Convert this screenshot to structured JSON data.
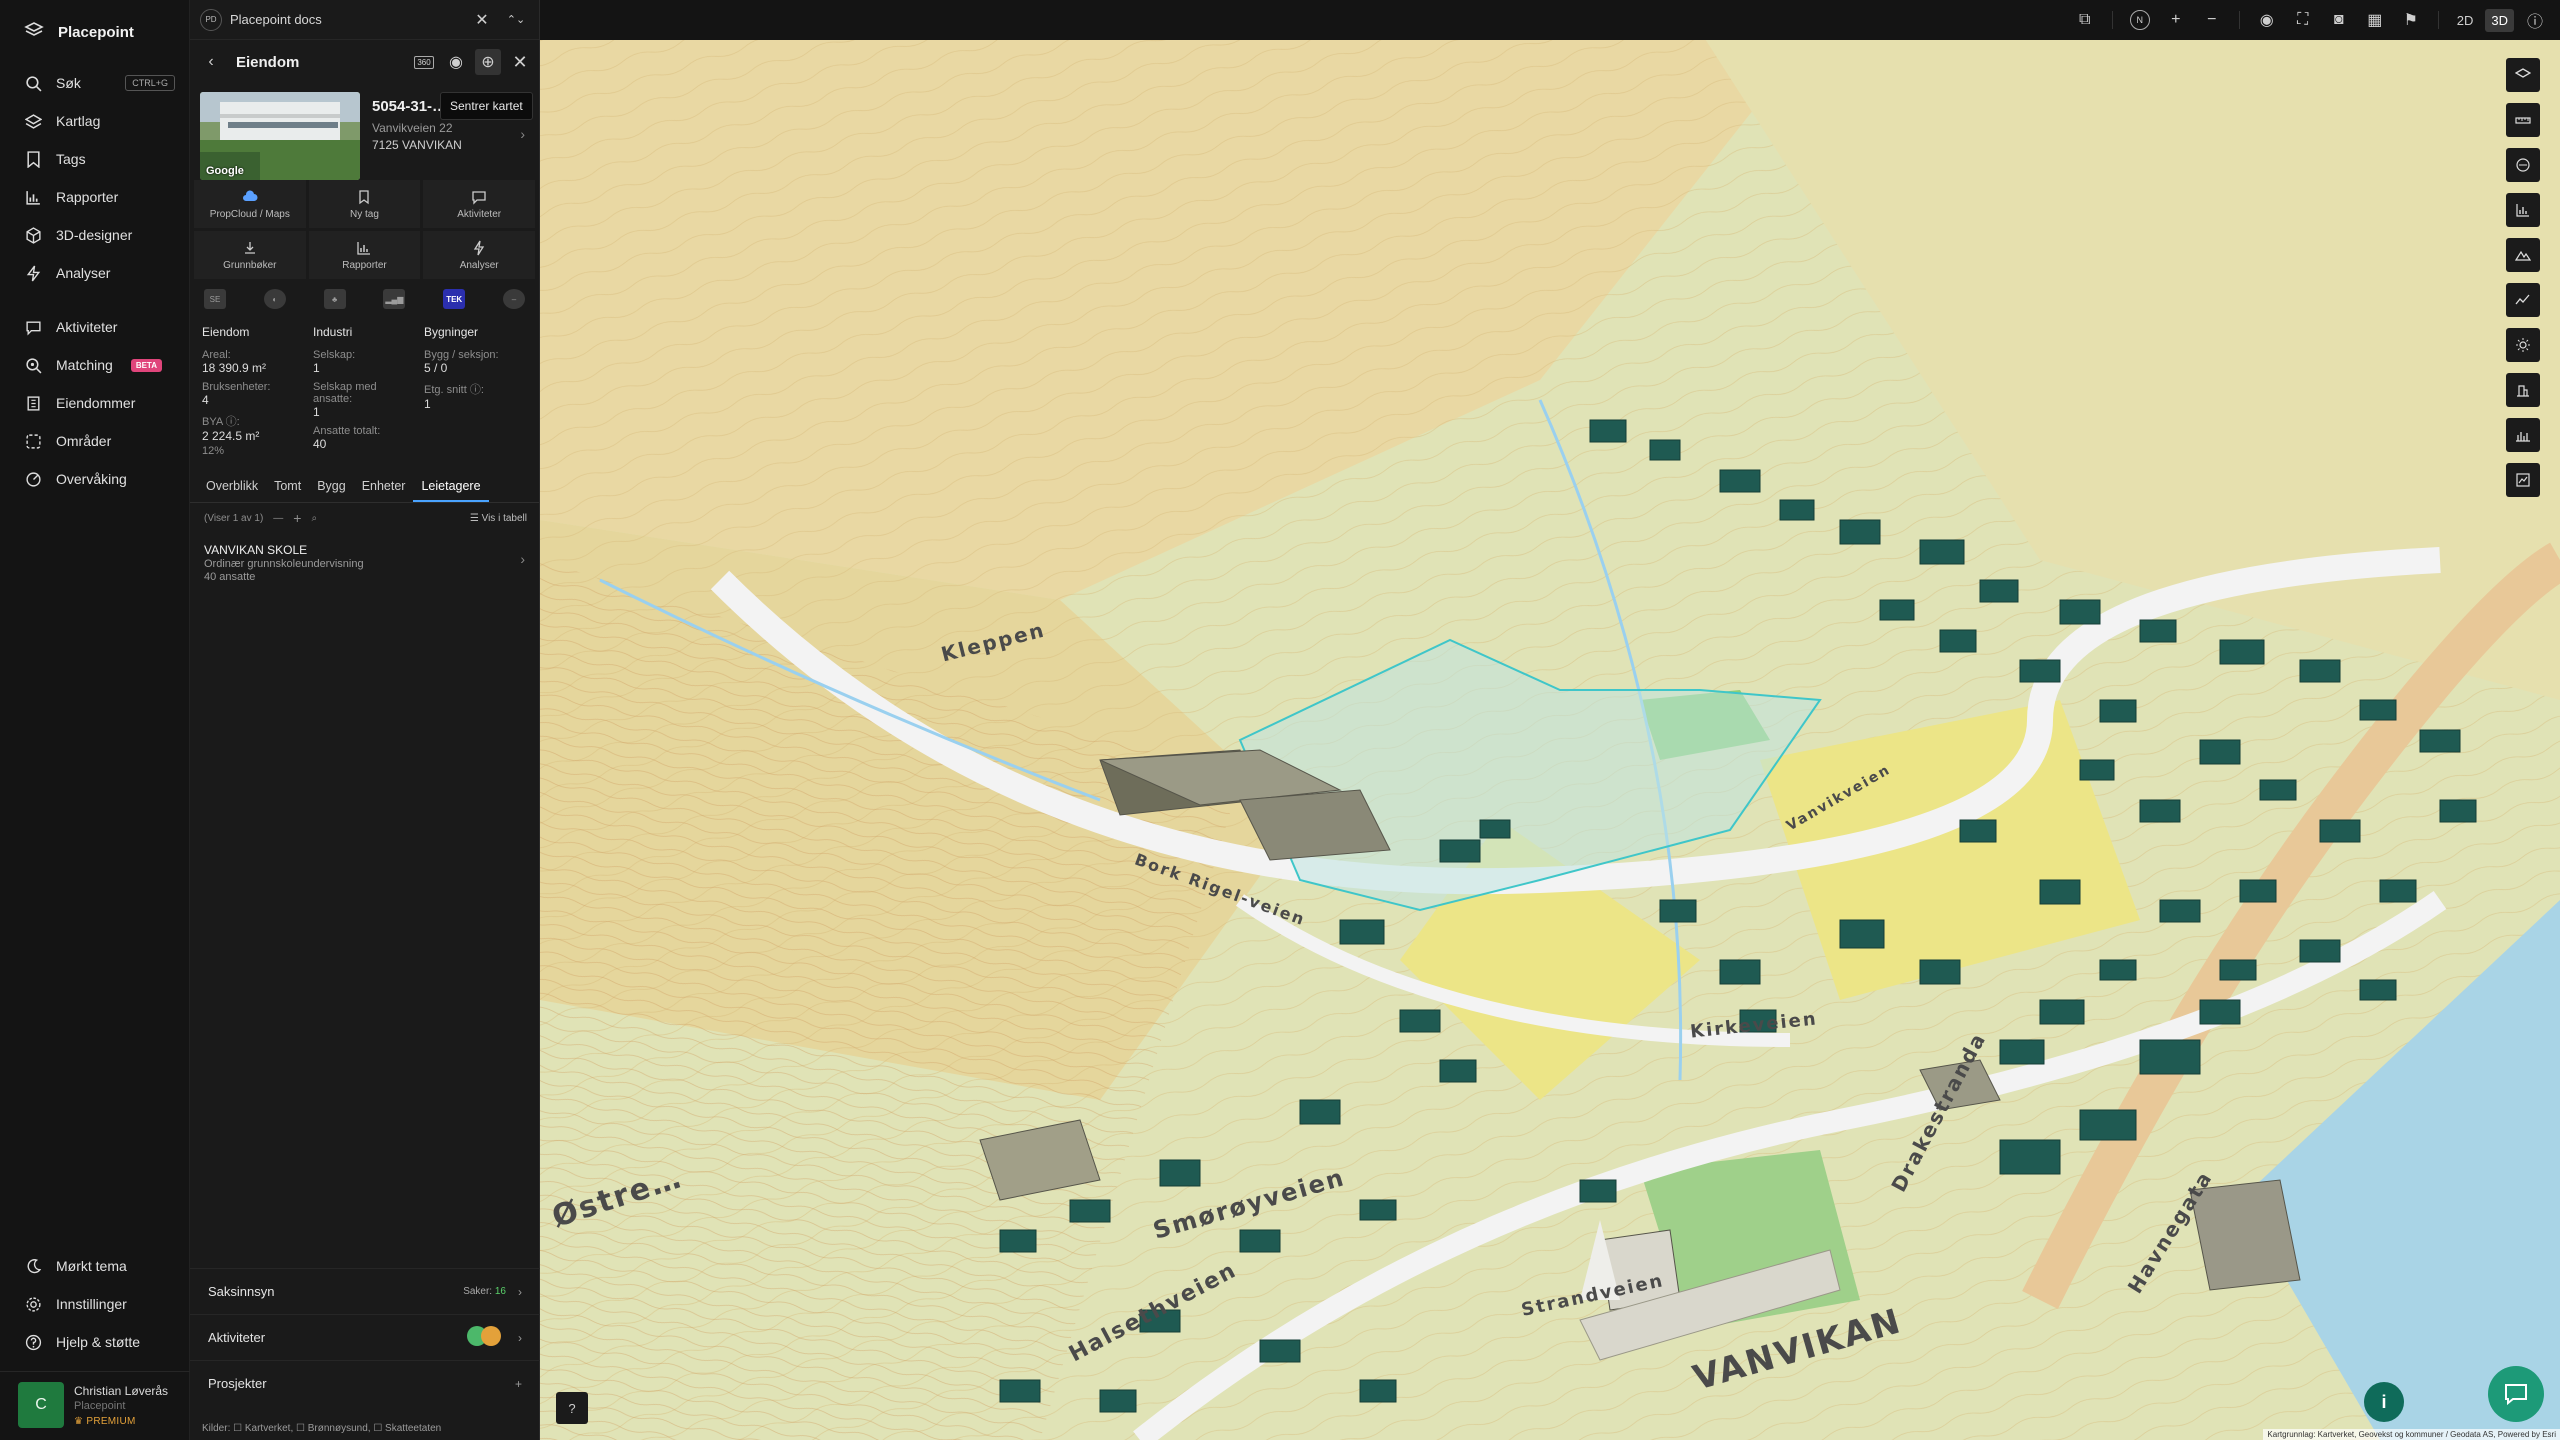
{
  "app": {
    "name": "Placepoint"
  },
  "nav": {
    "items": [
      {
        "label": "Søk",
        "shortcut": "CTRL+G"
      },
      {
        "label": "Kartlag"
      },
      {
        "label": "Tags"
      },
      {
        "label": "Rapporter"
      },
      {
        "label": "3D-designer"
      },
      {
        "label": "Analyser"
      },
      {
        "label": "Aktiviteter"
      },
      {
        "label": "Matching",
        "badge": "BETA"
      },
      {
        "label": "Eiendommer"
      },
      {
        "label": "Områder"
      },
      {
        "label": "Overvåking"
      }
    ],
    "bottom": [
      {
        "label": "Mørkt tema"
      },
      {
        "label": "Innstillinger"
      },
      {
        "label": "Hjelp & støtte"
      }
    ],
    "user": {
      "initial": "C",
      "name": "Christian Løverås",
      "org": "Placepoint",
      "plan": "PREMIUM"
    }
  },
  "docs": {
    "badge": "PD",
    "title": "Placepoint docs"
  },
  "panel": {
    "title": "Eiendom",
    "tooltip": "Sentrer kartet",
    "property": {
      "id": "5054-31-… 0 0",
      "address": "Vanvikveien 22",
      "postal": "7125 VANVIKAN",
      "photo_credit": "Google"
    },
    "actions": [
      {
        "label": "PropCloud / Maps"
      },
      {
        "label": "Ny tag"
      },
      {
        "label": "Aktiviteter"
      },
      {
        "label": "Grunnbøker"
      },
      {
        "label": "Rapporter"
      },
      {
        "label": "Analyser"
      }
    ],
    "sources_icons": [
      "SE",
      "",
      "",
      "",
      "TEK",
      ""
    ],
    "stats": {
      "eiendom": {
        "title": "Eiendom",
        "areal_label": "Areal:",
        "areal": "18 390.9 m²",
        "bruks_label": "Bruksenheter:",
        "bruks": "4",
        "bya_label": "BYA ⓘ:",
        "bya": "2 224.5 m²",
        "bya_pct": "12%"
      },
      "industri": {
        "title": "Industri",
        "selskap_label": "Selskap:",
        "selskap": "1",
        "selskap_ans_label": "Selskap med ansatte:",
        "selskap_ans": "1",
        "ansatte_label": "Ansatte totalt:",
        "ansatte": "40"
      },
      "bygninger": {
        "title": "Bygninger",
        "bygg_label": "Bygg / seksjon:",
        "bygg": "5 / 0",
        "etg_label": "Etg. snitt ⓘ:",
        "etg": "1"
      }
    },
    "tabs": [
      "Overblikk",
      "Tomt",
      "Bygg",
      "Enheter",
      "Leietagere"
    ],
    "active_tab": "Leietagere",
    "list": {
      "count": "(Viser 1 av 1)",
      "view_table": "Vis i tabell"
    },
    "tenants": [
      {
        "name": "VANVIKAN SKOLE",
        "desc": "Ordinær grunnskoleundervisning",
        "employees": "40 ansatte"
      }
    ],
    "sections": {
      "saksinnsyn": {
        "label": "Saksinnsyn",
        "meta_label": "Saker:",
        "meta_value": "16"
      },
      "aktiviteter": {
        "label": "Aktiviteter"
      },
      "prosjekter": {
        "label": "Prosjekter"
      }
    },
    "sources": "Kilder: ☐ Kartverket, ☐ Brønnøysund, ☐ Skatteetaten"
  },
  "map": {
    "view_modes": [
      "2D",
      "3D"
    ],
    "active_view": "3D",
    "labels": [
      "Kleppen",
      "Vanvikveien",
      "Kirkeveien",
      "Drakestranda",
      "Havnegata",
      "Smørøyveien",
      "Halsethveien",
      "Østre…",
      "VANVIKAN",
      "Strandveien",
      "Bork Rigel-veien"
    ],
    "attribution": "Kartgrunnlag: Kartverket, Geovekst og kommuner / Geodata AS, Powered by Esri",
    "colors": {
      "terrain": "#dfe3b4",
      "field": "#e6dc9c",
      "grass": "#a7d48a",
      "building": "#1f5a52",
      "water": "#a9d4e6",
      "road": "#f1f1f1",
      "selection": "#3fc6c9"
    }
  }
}
